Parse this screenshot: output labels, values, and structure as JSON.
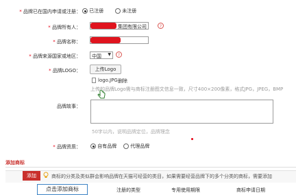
{
  "form": {
    "registered": {
      "label": "品牌已在国内申请或注册：",
      "opt_yes": "已注册",
      "opt_no": "未注册"
    },
    "owner": {
      "label": "品牌所有人：",
      "value": "集团有限公司"
    },
    "brand_name": {
      "label": "品牌名称："
    },
    "origin": {
      "label": "品牌来源国家或地区：",
      "selected": "中国"
    },
    "logo": {
      "label": "品牌LOGO：",
      "upload_btn": "上传Logo",
      "file_name": "logo.JPG",
      "delete_link": "删除",
      "hint": "上传的品牌Logo需与商标注册图文信息一致，尺寸400×200像素，格式JPG，JPEG，BMP"
    },
    "story": {
      "label": "品牌故事：",
      "hint": "50字以内，说明品牌定位，品牌理念"
    },
    "qualification": {
      "label": "品牌资质：",
      "opt_own": "自有品牌",
      "opt_agent": "代理品牌"
    }
  },
  "trademark": {
    "section_title": "添加商标",
    "add_button": "添加",
    "notice": "商标的分类及类似群会影响品牌在天猫可经营的类目，如果需要经营品牌下的多个分类的商标，需要添加",
    "tooltip": "点击添加商标",
    "columns": [
      "注册的类型",
      "专用使用期限",
      "商标申请日期"
    ]
  },
  "icons": [
    "help-icon",
    "dropdown-arrow-icon",
    "file-icon",
    "cursor-hand-icon",
    "lightbulb-icon"
  ],
  "colors": {
    "required": "#e60012",
    "add_button": "#c9302c",
    "tooltip_border": "#3b82c4"
  }
}
